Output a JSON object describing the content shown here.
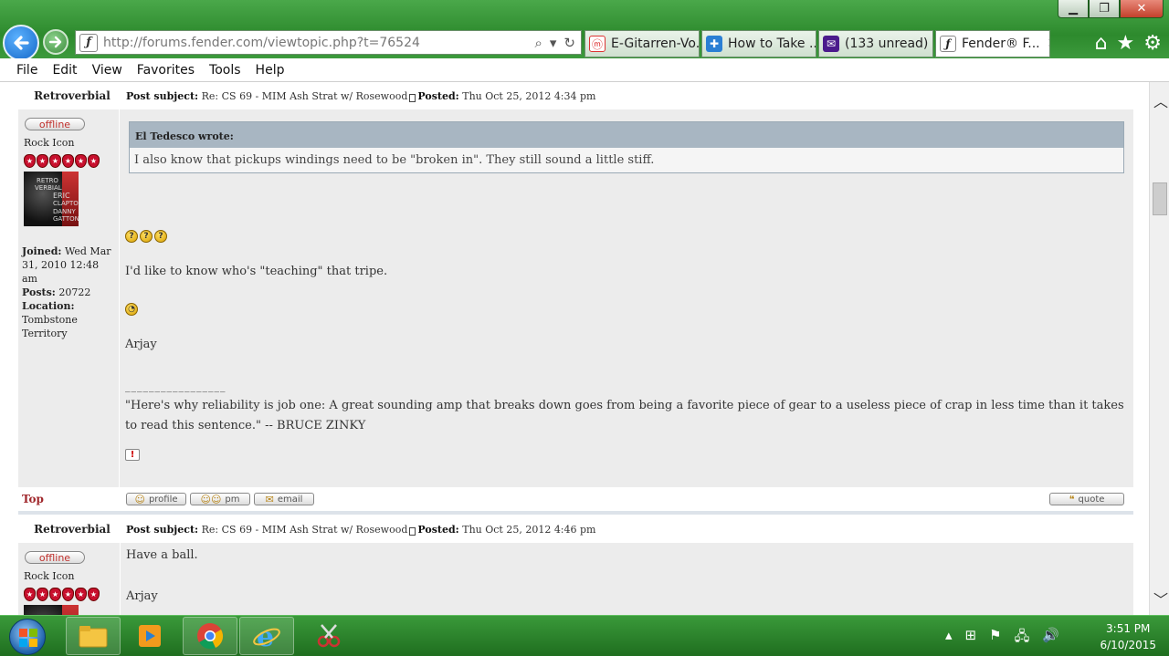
{
  "browser": {
    "url": "http://forums.fender.com/viewtopic.php?t=76524",
    "tabs": [
      {
        "title": "E-Gitarren-Vo..."
      },
      {
        "title": "How to Take ..."
      },
      {
        "title": "(133 unread) ..."
      },
      {
        "title": "Fender® F..."
      }
    ],
    "menu": [
      "File",
      "Edit",
      "View",
      "Favorites",
      "Tools",
      "Help"
    ],
    "icons": {
      "back": "back-arrow-icon",
      "forward": "forward-arrow-icon",
      "home": "home-icon",
      "favorites": "star-icon",
      "tools": "gear-icon"
    }
  },
  "posts": [
    {
      "author": "Retroverbial",
      "subject_label": "Post subject:",
      "subject": "Re: CS 69 - MIM Ash Strat w/ Rosewood",
      "posted_label": "Posted:",
      "posted": "Thu Oct 25, 2012 4:34 pm",
      "status": "offline",
      "rank": "Rock Icon",
      "joined_label": "Joined:",
      "joined": "Wed Mar 31, 2010 12:48 am",
      "posts_label": "Posts:",
      "posts": "20722",
      "location_label": "Location:",
      "location": "Tombstone Territory",
      "quote_author": "El Tedesco wrote:",
      "quote_text": "I also know that pickups windings need to be \"broken in\". They still sound a little stiff.",
      "para1": "I'd like to know who's \"teaching\" that tripe.",
      "signoff": "Arjay",
      "sig_line": "_________________",
      "sig_quote": "\"Here's why reliability is job one: A great sounding amp that breaks down goes from being a favorite piece of gear to a useless piece of crap in less time than it takes to read this sentence.\" -- BRUCE ZINKY",
      "top_link": "Top",
      "buttons": {
        "profile": "profile",
        "pm": "pm",
        "email": "email",
        "quote": "quote"
      }
    },
    {
      "author": "Retroverbial",
      "subject_label": "Post subject:",
      "subject": "Re: CS 69 - MIM Ash Strat w/ Rosewood",
      "posted_label": "Posted:",
      "posted": "Thu Oct 25, 2012 4:46 pm",
      "status": "offline",
      "rank": "Rock Icon",
      "para1": "Have a ball.",
      "signoff": "Arjay"
    }
  ],
  "avatar_text": [
    "RETRO",
    "VERBIAL",
    "ERIC",
    "CLAPTON",
    "DANNY",
    "GATTON"
  ],
  "taskbar": {
    "time": "3:51 PM",
    "date": "6/10/2015"
  }
}
